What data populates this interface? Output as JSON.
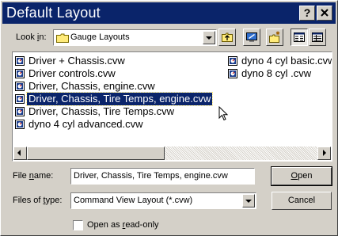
{
  "window": {
    "title": "Default Layout",
    "help_glyph": "?",
    "close_glyph": "✕"
  },
  "look_in": {
    "label_pre": "Look ",
    "label_underlined": "i",
    "label_post": "n:",
    "value": "Gauge Layouts",
    "icon": "folder-icon"
  },
  "toolbar": {
    "buttons": [
      "up-one-level-icon",
      "desktop-icon",
      "new-folder-icon",
      "list-view-icon",
      "details-view-icon"
    ]
  },
  "file_list": {
    "items": [
      {
        "name": "Driver + Chassis.cvw",
        "selected": false
      },
      {
        "name": "Driver controls.cvw",
        "selected": false
      },
      {
        "name": "Driver, Chassis, engine.cvw",
        "selected": false
      },
      {
        "name": "Driver, Chassis, Tire Temps, engine.cvw",
        "selected": true
      },
      {
        "name": "Driver, Chassis, Tire Temps.cvw",
        "selected": false
      },
      {
        "name": "dyno 4 cyl advanced.cvw",
        "selected": false
      },
      {
        "name": "dyno 4 cyl basic.cvw",
        "selected": false
      },
      {
        "name": "dyno 8 cyl .cvw",
        "selected": false
      }
    ],
    "file_icon": "layout-file-icon"
  },
  "file_name": {
    "label_pre": "File ",
    "label_underlined": "n",
    "label_post": "ame:",
    "value": "Driver, Chassis, Tire Temps, engine.cvw"
  },
  "files_of_type": {
    "label_pre": "Files of ",
    "label_underlined": "t",
    "label_post": "ype:",
    "value": "Command View Layout (*.cvw)"
  },
  "buttons": {
    "open_underlined": "O",
    "open_rest": "pen",
    "cancel": "Cancel"
  },
  "read_only": {
    "label_pre": "Open as ",
    "label_underlined": "r",
    "label_post": "ead-only",
    "checked": false
  },
  "colors": {
    "titlebar": "#0a246a",
    "face": "#d4d0c8",
    "selection": "#0a246a"
  }
}
